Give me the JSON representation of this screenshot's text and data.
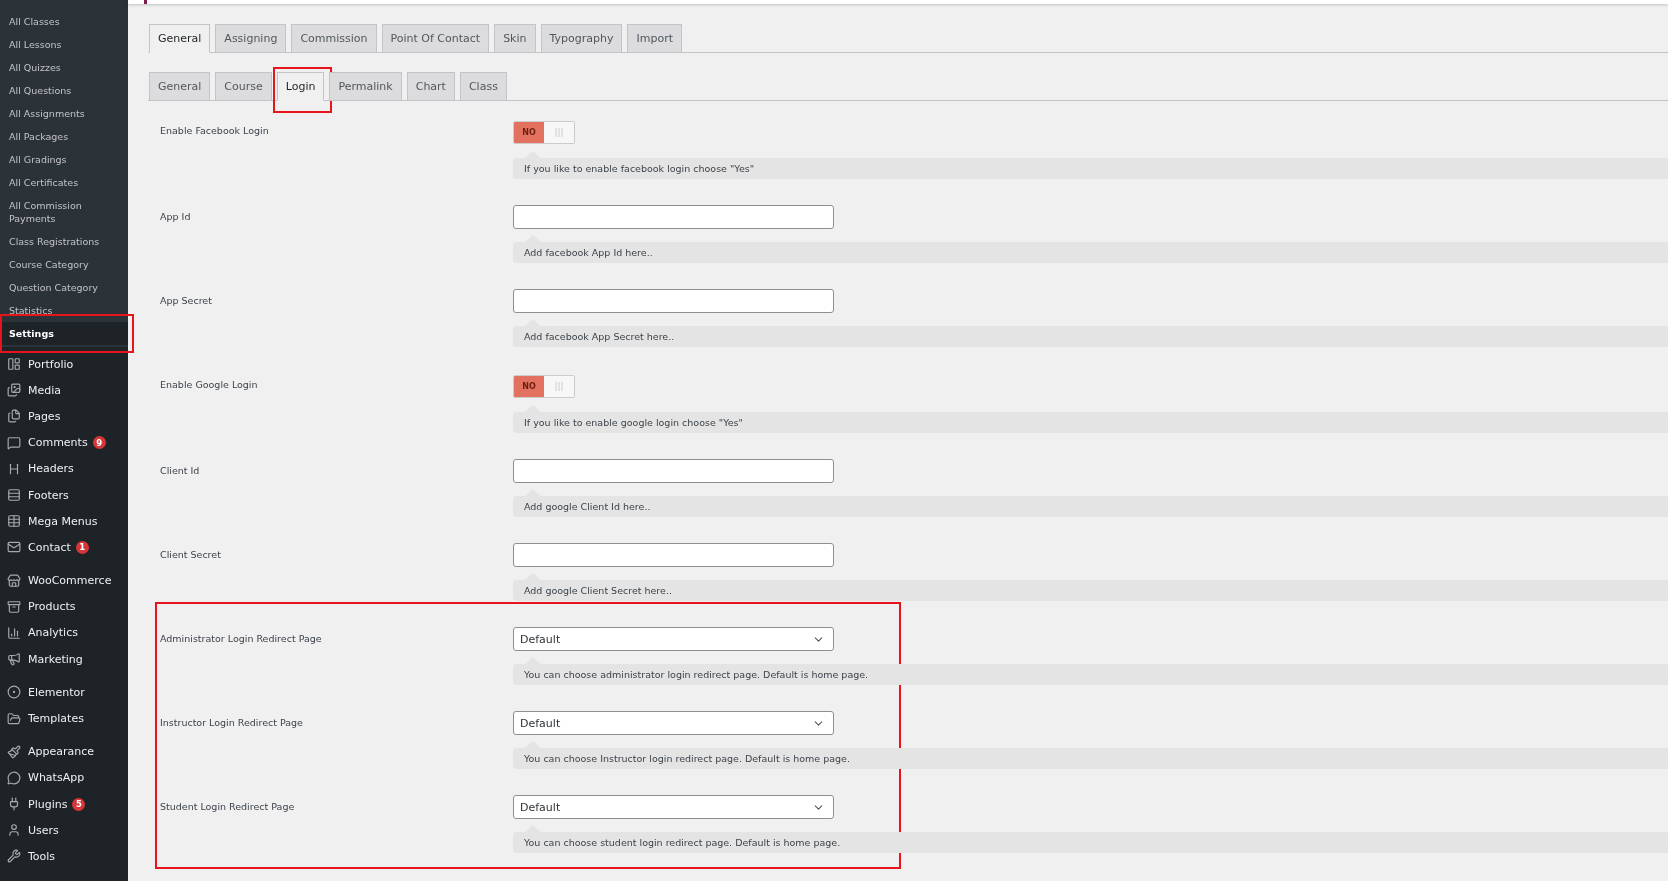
{
  "sidebar": {
    "submenu": [
      {
        "label": "All Classes",
        "selected": false,
        "highlighted": false
      },
      {
        "label": "All Lessons",
        "selected": false,
        "highlighted": false
      },
      {
        "label": "All Quizzes",
        "selected": false,
        "highlighted": false
      },
      {
        "label": "All Questions",
        "selected": false,
        "highlighted": false
      },
      {
        "label": "All Assignments",
        "selected": false,
        "highlighted": false
      },
      {
        "label": "All Packages",
        "selected": false,
        "highlighted": false
      },
      {
        "label": "All Gradings",
        "selected": false,
        "highlighted": false
      },
      {
        "label": "All Certificates",
        "selected": false,
        "highlighted": false
      },
      {
        "label": "All Commission Payments",
        "selected": false,
        "highlighted": false
      },
      {
        "label": "Class Registrations",
        "selected": false,
        "highlighted": false
      },
      {
        "label": "Course Category",
        "selected": false,
        "highlighted": false
      },
      {
        "label": "Question Category",
        "selected": false,
        "highlighted": false
      },
      {
        "label": "Statistics",
        "selected": false,
        "highlighted": false
      },
      {
        "label": "Settings",
        "selected": true,
        "highlighted": true
      }
    ],
    "menu_groups": [
      [
        {
          "label": "Portfolio"
        },
        {
          "label": "Media"
        },
        {
          "label": "Pages"
        },
        {
          "label": "Comments",
          "badge": "9"
        },
        {
          "label": "Headers"
        },
        {
          "label": "Footers"
        },
        {
          "label": "Mega Menus"
        },
        {
          "label": "Contact",
          "badge": "1"
        }
      ],
      [
        {
          "label": "WooCommerce"
        },
        {
          "label": "Products"
        },
        {
          "label": "Analytics"
        },
        {
          "label": "Marketing"
        }
      ],
      [
        {
          "label": "Elementor"
        },
        {
          "label": "Templates"
        }
      ],
      [
        {
          "label": "Appearance"
        },
        {
          "label": "WhatsApp"
        },
        {
          "label": "Plugins",
          "badge": "5"
        },
        {
          "label": "Users"
        },
        {
          "label": "Tools"
        }
      ]
    ]
  },
  "tabs": [
    {
      "label": "General",
      "selected": true
    },
    {
      "label": "Assigning",
      "selected": false
    },
    {
      "label": "Commission",
      "selected": false
    },
    {
      "label": "Point Of Contact",
      "selected": false
    },
    {
      "label": "Skin",
      "selected": false
    },
    {
      "label": "Typography",
      "selected": false
    },
    {
      "label": "Import",
      "selected": false
    }
  ],
  "subtabs": [
    {
      "label": "General",
      "selected": false,
      "highlighted": false
    },
    {
      "label": "Course",
      "selected": false,
      "highlighted": false
    },
    {
      "label": "Login",
      "selected": true,
      "highlighted": true
    },
    {
      "label": "Permalink",
      "selected": false,
      "highlighted": false
    },
    {
      "label": "Chart",
      "selected": false,
      "highlighted": false
    },
    {
      "label": "Class",
      "selected": false,
      "highlighted": false
    }
  ],
  "field_groups": [
    {
      "fields": [
        {
          "kind": "toggle",
          "label": "Enable Facebook Login",
          "on": false,
          "off_text": "NO",
          "help": "If you like to enable facebook login choose \"Yes\""
        },
        {
          "kind": "text",
          "label": "App Id",
          "help": "Add facebook App Id here.."
        },
        {
          "kind": "text",
          "label": "App Secret",
          "help": "Add facebook App Secret here.."
        },
        {
          "kind": "toggle",
          "label": "Enable Google Login",
          "on": false,
          "off_text": "NO",
          "help": "If you like to enable google login choose \"Yes\""
        },
        {
          "kind": "text",
          "label": "Client Id",
          "help": "Add google Client Id here.."
        },
        {
          "kind": "text",
          "label": "Client Secret",
          "help": "Add google Client Secret here.."
        }
      ]
    },
    {
      "highlighted": true,
      "fields": [
        {
          "kind": "select",
          "label": "Administrator Login Redirect Page",
          "value": "Default",
          "help": "You can choose administrator login redirect page. Default is home page."
        },
        {
          "kind": "select",
          "label": "Instructor Login Redirect Page",
          "value": "Default",
          "help": "You can choose Instructor login redirect page. Default is home page."
        },
        {
          "kind": "select",
          "label": "Student Login Redirect Page",
          "value": "Default",
          "help": "You can choose student login redirect page. Default is home page."
        }
      ]
    }
  ]
}
